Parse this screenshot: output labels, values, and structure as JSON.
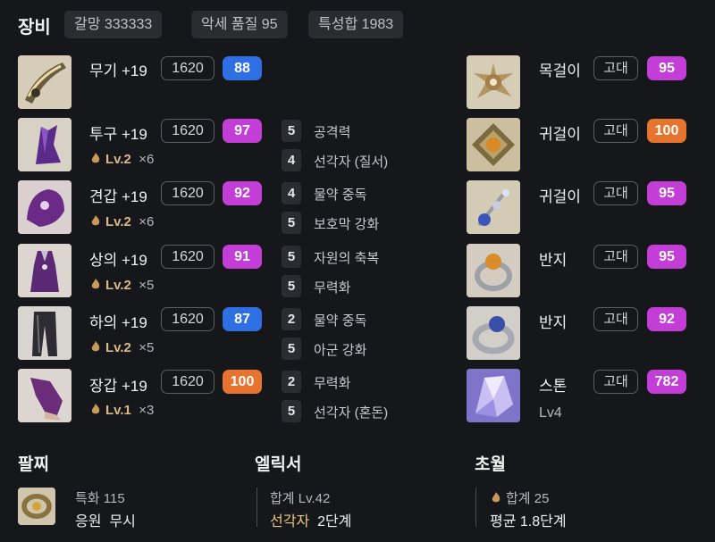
{
  "header": {
    "title": "장비",
    "chips": [
      "갈망 333333",
      "악세 품질 95",
      "특성합 1983"
    ]
  },
  "equipment": [
    {
      "name": "무기 +19",
      "ilvl": "1620",
      "quality": "88",
      "qcolor": "blue"
    },
    {
      "name": "투구 +19",
      "ilvl": "1620",
      "quality": "97",
      "qcolor": "purple",
      "lv": "Lv.2",
      "count": "×6"
    },
    {
      "name": "견갑 +19",
      "ilvl": "1620",
      "quality": "92",
      "qcolor": "purple",
      "lv": "Lv.2",
      "count": "×6"
    },
    {
      "name": "상의 +19",
      "ilvl": "1620",
      "quality": "91",
      "qcolor": "purple",
      "lv": "Lv.2",
      "count": "×5"
    },
    {
      "name": "하의 +19",
      "ilvl": "1620",
      "quality": "87",
      "qcolor": "blue",
      "lv": "Lv.2",
      "count": "×5"
    },
    {
      "name": "장갑 +19",
      "ilvl": "1620",
      "quality": "100",
      "qcolor": "orange",
      "lv": "Lv.1",
      "count": "×3"
    }
  ],
  "engravings": [
    {
      "level": "5",
      "name": "공격력"
    },
    {
      "level": "4",
      "name": "선각자 (질서)"
    },
    {
      "level": "4",
      "name": "물약 중독"
    },
    {
      "level": "5",
      "name": "보호막 강화"
    },
    {
      "level": "5",
      "name": "자원의 축복"
    },
    {
      "level": "5",
      "name": "무력화"
    },
    {
      "level": "2",
      "name": "물약 중독"
    },
    {
      "level": "5",
      "name": "아군 강화"
    },
    {
      "level": "2",
      "name": "무력화"
    },
    {
      "level": "5",
      "name": "선각자 (혼돈)"
    }
  ],
  "accessories": [
    {
      "name": "목걸이",
      "tier": "고대",
      "quality": "95",
      "qcolor": "purple"
    },
    {
      "name": "귀걸이",
      "tier": "고대",
      "quality": "100",
      "qcolor": "orange"
    },
    {
      "name": "귀걸이",
      "tier": "고대",
      "quality": "95",
      "qcolor": "purple"
    },
    {
      "name": "반지",
      "tier": "고대",
      "quality": "95",
      "qcolor": "purple"
    },
    {
      "name": "반지",
      "tier": "고대",
      "quality": "92",
      "qcolor": "purple"
    },
    {
      "name": "스톤",
      "tier": "고대",
      "quality": "782",
      "qcolor": "purple",
      "extra": "Lv4"
    }
  ],
  "bracelet": {
    "title": "팔찌",
    "line1": "특화 115",
    "line2a": "응원",
    "line2b": "무시"
  },
  "elixir": {
    "title": "엘릭서",
    "line1": "합계 Lv.42",
    "line2a": "선각자",
    "line2b": "2단계"
  },
  "transcend": {
    "title": "초월",
    "line1": "합계 25",
    "line2": "평균 1.8단계"
  },
  "colors": {
    "blue": "#2f6fe4",
    "purple": "#c23ed6",
    "orange": "#e6732e",
    "bg": "#16171b"
  },
  "icons": [
    "weapon-icon",
    "helmet-icon",
    "shoulder-icon",
    "chest-icon",
    "pants-icon",
    "gloves-icon",
    "necklace-icon",
    "earring-icon",
    "ring-icon",
    "stone-icon",
    "bracelet-icon",
    "flame-icon"
  ]
}
